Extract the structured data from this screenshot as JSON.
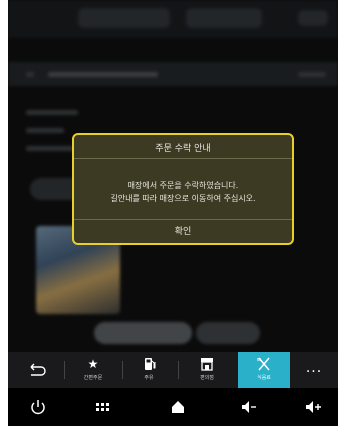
{
  "dialog": {
    "title": "주문 수락 안내",
    "message_line1": "매장에서 주문을 수락하였습니다.",
    "message_line2": "길안내를 따라 매장으로 이동하여 주십시오.",
    "confirm_label": "확인"
  },
  "bottom_nav": {
    "items": [
      {
        "icon": "back-arrow-icon",
        "label": ""
      },
      {
        "icon": "star-icon",
        "label": "간편주문"
      },
      {
        "icon": "fuel-pump-icon",
        "label": "주유"
      },
      {
        "icon": "store-icon",
        "label": "편의점"
      },
      {
        "icon": "fork-knife-icon",
        "label": "식음료"
      },
      {
        "icon": "more-icon",
        "label": "..."
      }
    ],
    "active_index": 4,
    "accent_color": "#2ab0c8"
  },
  "system_bar": {
    "items": [
      "power-icon",
      "grid-menu-icon",
      "home-icon",
      "volume-down-icon",
      "volume-up-icon"
    ]
  },
  "colors": {
    "dialog_border": "#e8cf2a",
    "dialog_bg": "#3c3a22"
  }
}
